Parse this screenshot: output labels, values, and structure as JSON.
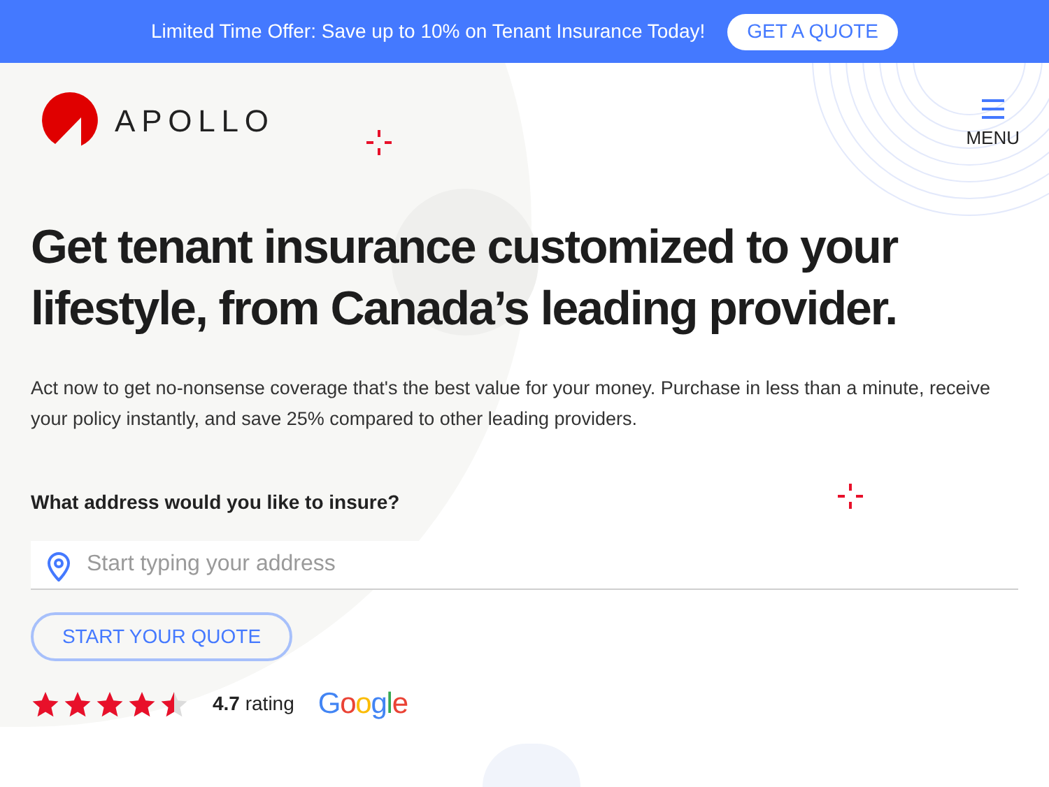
{
  "banner": {
    "text": "Limited Time Offer: Save up to 10% on Tenant Insurance Today!",
    "button": "GET A QUOTE"
  },
  "header": {
    "logo_text": "APOLLO",
    "menu_label": "MENU"
  },
  "hero": {
    "headline": "Get tenant insurance customized to your lifestyle, from Canada’s leading provider.",
    "description": "Act now to get no-nonsense coverage that's the best value for your money. Purchase in less than a minute, receive your policy instantly, and save 25% compared to other leading providers.",
    "address_label": "What address would you like to insure?",
    "address_placeholder": "Start typing your address",
    "button": "START YOUR QUOTE",
    "rating": {
      "stars": 4.5,
      "value": "4.7",
      "label": "rating",
      "source": "Google"
    }
  }
}
